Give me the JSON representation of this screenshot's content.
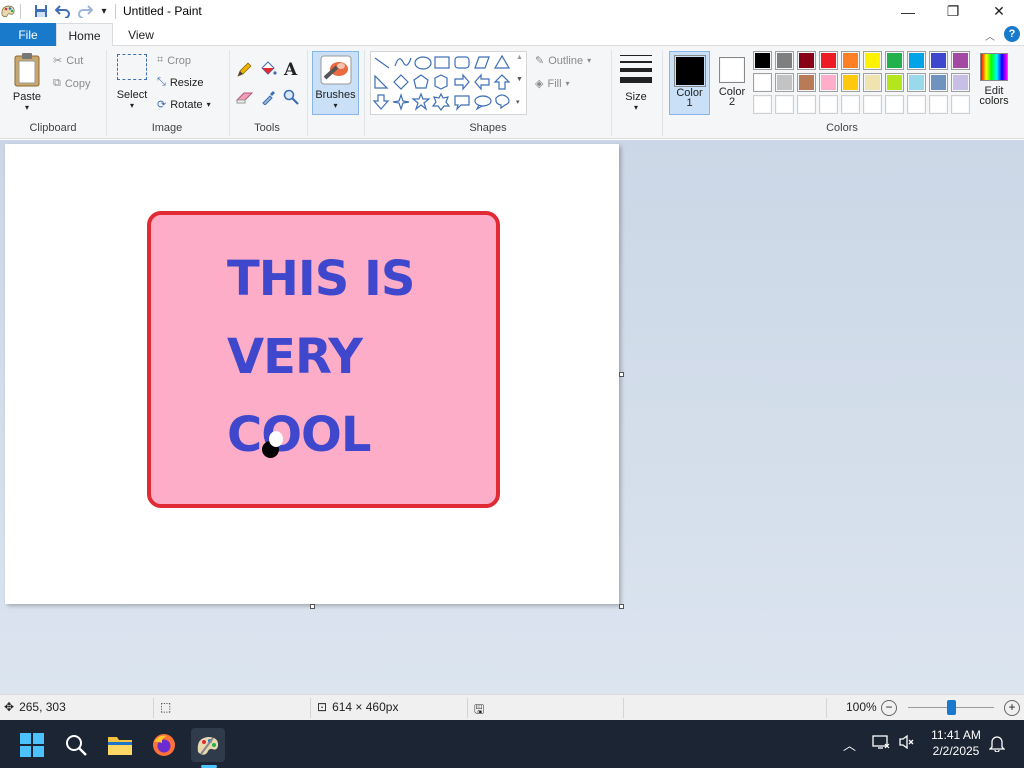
{
  "window": {
    "title": "Untitled - Paint",
    "minimize_glyph": "—",
    "maximize_glyph": "❐",
    "close_glyph": "✕"
  },
  "tabs": {
    "file": "File",
    "home": "Home",
    "view": "View"
  },
  "ribbon": {
    "clipboard": {
      "paste": "Paste",
      "cut": "Cut",
      "copy": "Copy",
      "group": "Clipboard"
    },
    "image": {
      "select": "Select",
      "crop": "Crop",
      "resize": "Resize",
      "rotate": "Rotate",
      "group": "Image"
    },
    "tools": {
      "group": "Tools",
      "text_tool": "A"
    },
    "brushes": {
      "label": "Brushes"
    },
    "shapes": {
      "outline": "Outline",
      "fill": "Fill",
      "group": "Shapes"
    },
    "size": {
      "label": "Size"
    },
    "colors": {
      "color1_label": "Color",
      "color1_num": "1",
      "color2_label": "Color",
      "color2_num": "2",
      "edit_label": "Edit",
      "edit_label2": "colors",
      "group": "Colors",
      "color1_value": "#000000",
      "color2_value": "#ffffff",
      "row1": [
        "#000000",
        "#7f7f7f",
        "#880015",
        "#ed1c24",
        "#ff7f27",
        "#fff200",
        "#22b14c",
        "#00a2e8",
        "#3f48cc",
        "#a349a4"
      ],
      "row2": [
        "#ffffff",
        "#c3c3c3",
        "#b97a57",
        "#ffaec9",
        "#ffc90e",
        "#efe4b0",
        "#b5e61d",
        "#99d9ea",
        "#7092be",
        "#c8bfe7"
      ],
      "row3": [
        "#ffffff",
        "#ffffff",
        "#ffffff",
        "#ffffff",
        "#ffffff",
        "#ffffff",
        "#ffffff",
        "#ffffff",
        "#ffffff",
        "#ffffff"
      ]
    },
    "help_glyph": "?"
  },
  "canvas": {
    "text_line1": "THIS IS",
    "text_line2": "VERY",
    "text_line3": "COOL",
    "box_fill": "#fdadc8",
    "box_border": "#e02a34",
    "text_color": "#3f48cc"
  },
  "status": {
    "cursor_pos": "265, 303",
    "canvas_size": "614 × 460px",
    "zoom": "100%",
    "zoom_level": 0.5
  },
  "taskbar": {
    "time": "11:41 AM",
    "date": "2/2/2025"
  }
}
